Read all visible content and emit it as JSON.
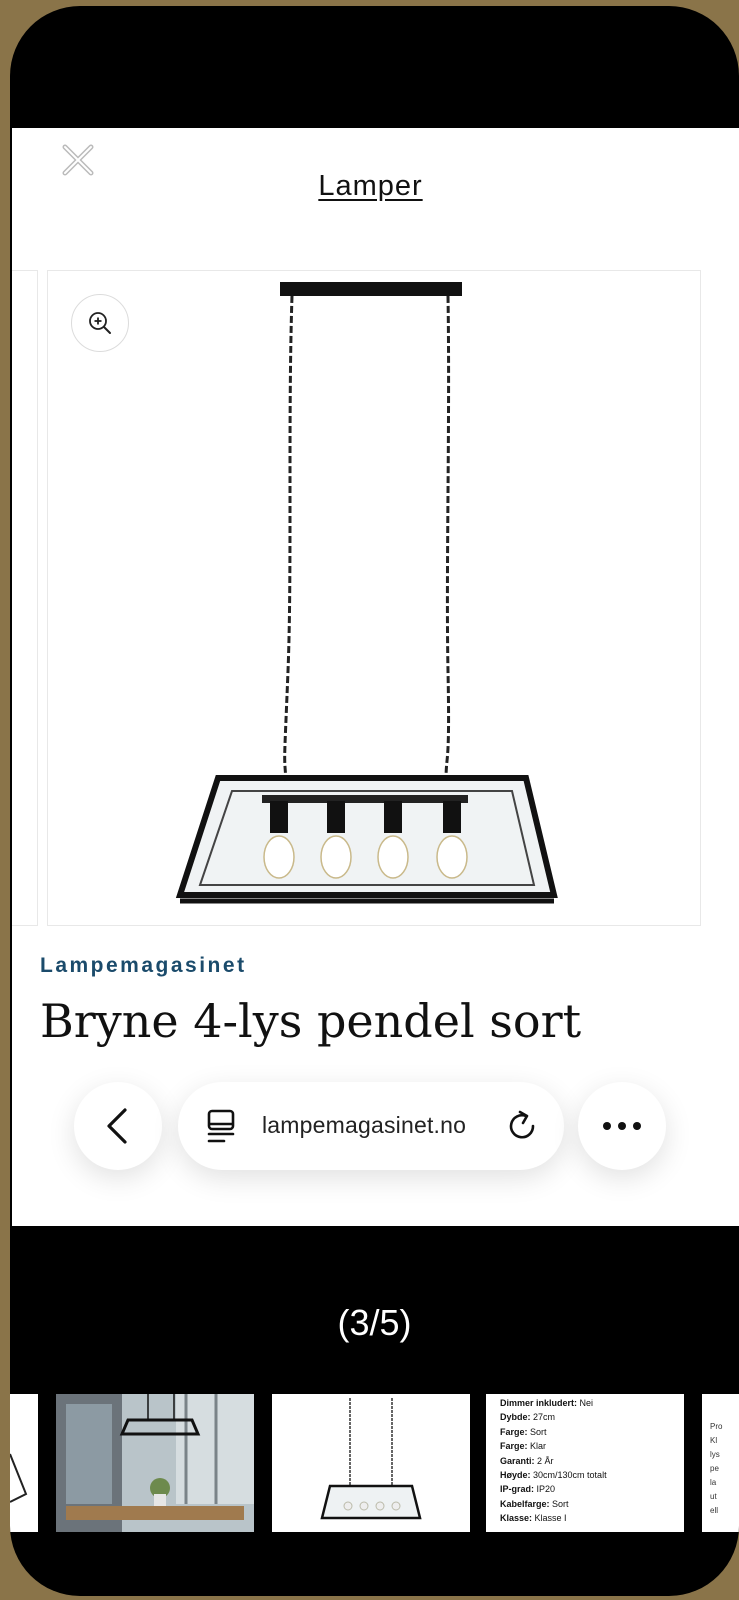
{
  "sheet": {
    "title": "Lamper",
    "close_icon": "close-icon",
    "zoom_icon": "zoom-in-icon"
  },
  "product": {
    "brand": "Lampemagasinet",
    "title": "Bryne 4-lys pendel sort"
  },
  "browser": {
    "url": "lampemagasinet.no",
    "back_icon": "chevron-left-icon",
    "tab_icon": "tab-overview-icon",
    "reload_icon": "reload-icon",
    "more_icon": "more-icon"
  },
  "gallery": {
    "counter": "(3/5)",
    "spec_lines": [
      {
        "key": "Dimmer inkludert:",
        "value": "Nei"
      },
      {
        "key": "Dybde:",
        "value": "27cm"
      },
      {
        "key": "Farge:",
        "value": "Sort"
      },
      {
        "key": "Farge:",
        "value": "Klar"
      },
      {
        "key": "Garanti:",
        "value": "2 År"
      },
      {
        "key": "Høyde:",
        "value": "30cm/130cm totalt"
      },
      {
        "key": "IP-grad:",
        "value": "IP20"
      },
      {
        "key": "Kabelfarge:",
        "value": "Sort"
      },
      {
        "key": "Klasse:",
        "value": "Klasse I"
      }
    ],
    "partial_text": {
      "heading": "Pro",
      "lines": [
        "Kl",
        "lys",
        "pe",
        "la",
        "ut",
        "ell"
      ]
    }
  },
  "colors": {
    "brand": "#1b4b6b",
    "frame_background": "#8a7449"
  }
}
